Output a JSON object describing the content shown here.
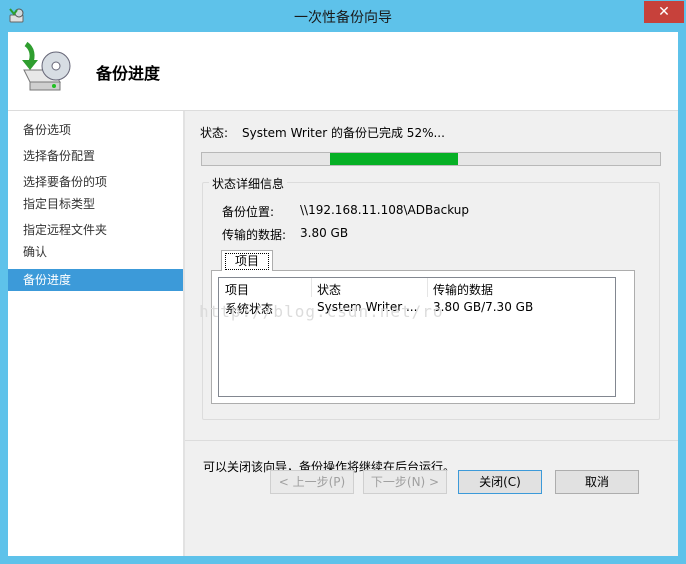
{
  "window": {
    "title": "一次性备份向导",
    "close_glyph": "✕"
  },
  "header": {
    "title": "备份进度"
  },
  "sidebar": {
    "items": [
      {
        "label": "备份选项"
      },
      {
        "label": "选择备份配置"
      },
      {
        "label": "选择要备份的项"
      },
      {
        "label": "指定目标类型"
      },
      {
        "label": "指定远程文件夹"
      },
      {
        "label": "确认"
      },
      {
        "label": "备份进度"
      }
    ],
    "active_index": 6
  },
  "status": {
    "label": "状态:",
    "text": "System Writer 的备份已完成 52%..."
  },
  "progress": {
    "visible_fill_start": 0.28,
    "visible_fill_end": 0.56
  },
  "details": {
    "title": "状态详细信息",
    "location_label": "备份位置:",
    "location_value": "\\\\192.168.11.108\\ADBackup",
    "transferred_label": "传输的数据:",
    "transferred_value": "3.80 GB",
    "tab_label": "项目",
    "columns": [
      "项目",
      "状态",
      "传输的数据"
    ],
    "rows": [
      {
        "item": "系统状态",
        "status": "System Writer ...",
        "data": "3.80 GB/7.30 GB"
      }
    ]
  },
  "note": "可以关闭该向导，备份操作将继续在后台运行。",
  "watermark": "http://blog.csdn.net/ro",
  "buttons": {
    "prev": "< 上一步(P)",
    "next": "下一步(N) >",
    "close": "关闭(C)",
    "cancel": "取消"
  },
  "colors": {
    "titlebar": "#5ec2ea",
    "progress": "#06b025",
    "selection": "#3c9ad9",
    "close": "#c7413b"
  }
}
